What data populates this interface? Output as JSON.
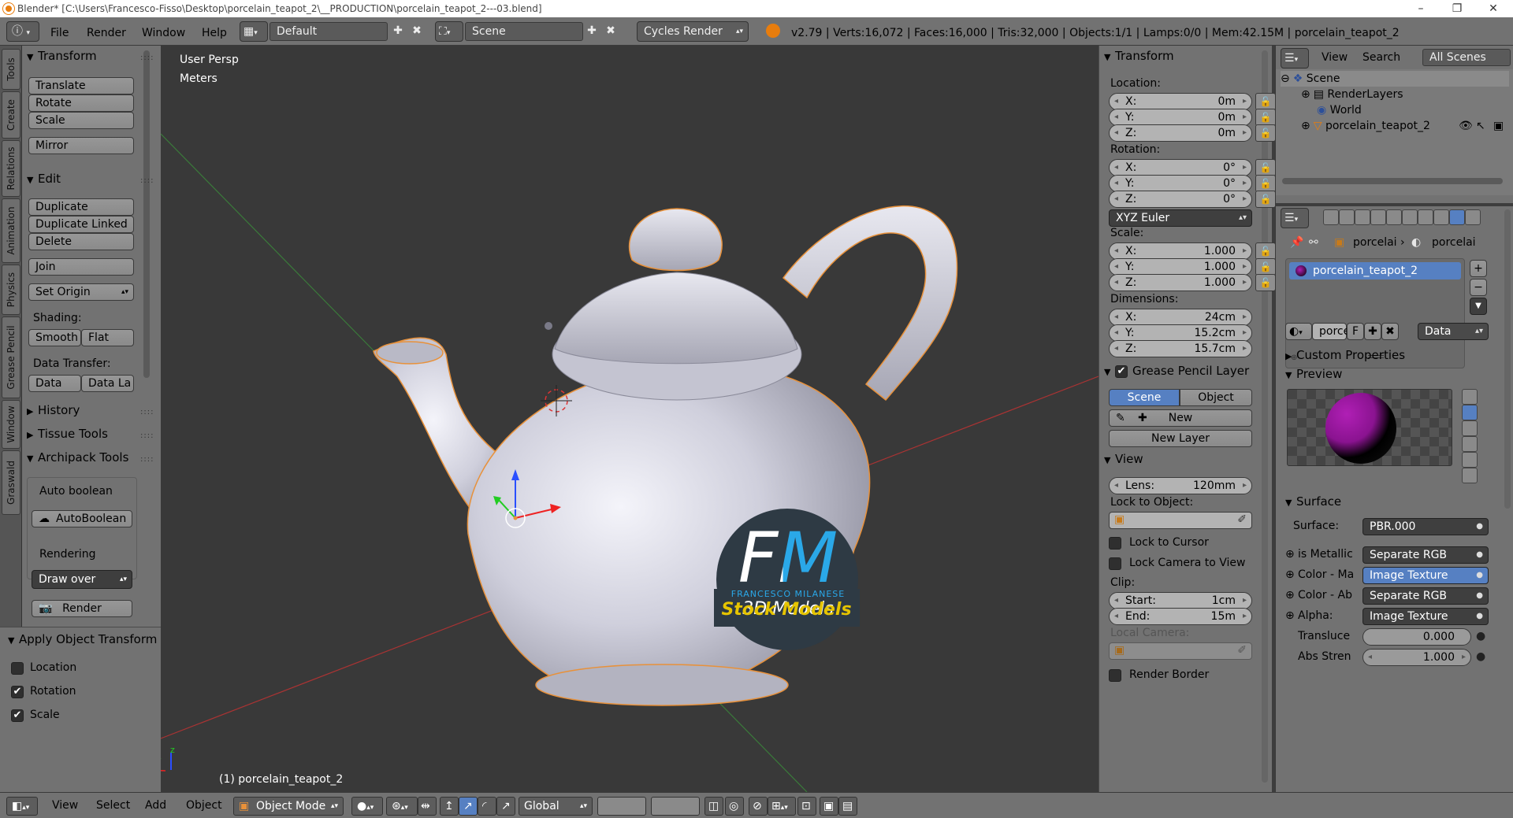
{
  "window": {
    "title": "Blender* [C:\\Users\\Francesco-Fisso\\Desktop\\porcelain_teapot_2\\__PRODUCTION\\porcelain_teapot_2---03.blend]"
  },
  "info_header": {
    "menus": [
      "File",
      "Render",
      "Window",
      "Help"
    ],
    "screen_layout": "Default",
    "scene": "Scene",
    "render_engine": "Cycles Render",
    "stats": "v2.79 | Verts:16,072 | Faces:16,000 | Tris:32,000 | Objects:1/1 | Lamps:0/0 | Mem:42.15M | porcelain_teapot_2"
  },
  "left_tabs": [
    "Tools",
    "Create",
    "Relations",
    "Animation",
    "Physics",
    "Grease Pencil",
    "Window",
    "Graswald"
  ],
  "tool_shelf": {
    "transform": {
      "title": "Transform",
      "buttons": [
        "Translate",
        "Rotate",
        "Scale",
        "Mirror"
      ]
    },
    "edit": {
      "title": "Edit",
      "buttons": [
        "Duplicate",
        "Duplicate Linked",
        "Delete",
        "Join",
        "Set Origin"
      ],
      "shading_label": "Shading:",
      "smooth": "Smooth",
      "flat": "Flat",
      "data_transfer_label": "Data Transfer:",
      "data": "Data",
      "data_la": "Data La"
    },
    "history": "History",
    "tissue_tools": "Tissue Tools",
    "archipack": {
      "title": "Archipack Tools",
      "auto_boolean": "Auto boolean",
      "autoboolean_btn": "AutoBoolean",
      "rendering": "Rendering",
      "draw_over": "Draw over",
      "render": "Render"
    }
  },
  "apply_object_transform": {
    "title": "Apply Object Transform",
    "options": [
      {
        "label": "Location",
        "checked": false
      },
      {
        "label": "Rotation",
        "checked": true
      },
      {
        "label": "Scale",
        "checked": true
      }
    ]
  },
  "viewport": {
    "view_name": "User Persp",
    "units": "Meters",
    "object_label": "(1) porcelain_teapot_2",
    "watermark": {
      "fm": "FM",
      "author": "FRANCESCO MILANESE",
      "sub": "3D Models",
      "stock": "Stock Models"
    },
    "colors": {
      "grid_x": "#a33",
      "grid_y": "#3a7a3a",
      "teapot": "#d4d4e0",
      "outline": "#e8913a"
    }
  },
  "n_panel": {
    "transform_title": "Transform",
    "location_label": "Location:",
    "location": [
      {
        "k": "X:",
        "v": "0m"
      },
      {
        "k": "Y:",
        "v": "0m"
      },
      {
        "k": "Z:",
        "v": "0m"
      }
    ],
    "rotation_label": "Rotation:",
    "rotation": [
      {
        "k": "X:",
        "v": "0°"
      },
      {
        "k": "Y:",
        "v": "0°"
      },
      {
        "k": "Z:",
        "v": "0°"
      }
    ],
    "rotation_mode": "XYZ Euler",
    "scale_label": "Scale:",
    "scale": [
      {
        "k": "X:",
        "v": "1.000"
      },
      {
        "k": "Y:",
        "v": "1.000"
      },
      {
        "k": "Z:",
        "v": "1.000"
      }
    ],
    "dimensions_label": "Dimensions:",
    "dimensions": [
      {
        "k": "X:",
        "v": "24cm"
      },
      {
        "k": "Y:",
        "v": "15.2cm"
      },
      {
        "k": "Z:",
        "v": "15.7cm"
      }
    ],
    "grease_pencil_title": "Grease Pencil Layer",
    "gp_scene": "Scene",
    "gp_object": "Object",
    "gp_new": "New",
    "gp_new_layer": "New Layer",
    "view_title": "View",
    "lens": {
      "k": "Lens:",
      "v": "120mm"
    },
    "lock_to_object": "Lock to Object:",
    "lock_to_cursor": "Lock to Cursor",
    "lock_camera": "Lock Camera to View",
    "clip_label": "Clip:",
    "clip_start": {
      "k": "Start:",
      "v": "1cm"
    },
    "clip_end": {
      "k": "End:",
      "v": "15m"
    },
    "local_camera": "Local Camera:",
    "render_border": "Render Border"
  },
  "outliner": {
    "menus": [
      "View",
      "Search"
    ],
    "filter": "All Scenes",
    "items": [
      "Scene",
      "RenderLayers",
      "World",
      "porcelain_teapot_2"
    ]
  },
  "properties": {
    "breadcrumb": [
      "porcelai",
      "porcelai"
    ],
    "material_slot": "porcelain_teapot_2",
    "material_name": "porce",
    "f_label": "F",
    "data_select": "Data",
    "custom_props": "Custom Properties",
    "preview": "Preview",
    "surface_title": "Surface",
    "surface_label": "Surface:",
    "surface_value": "PBR.000",
    "inputs": [
      {
        "label": "is Metallic",
        "value": "Separate RGB"
      },
      {
        "label": "Color - Ma",
        "value": "Image Texture"
      },
      {
        "label": "Color - Ab",
        "value": "Separate RGB"
      },
      {
        "label": "Alpha:",
        "value": "Image Texture"
      },
      {
        "label": "Transluce",
        "value": "0.000"
      },
      {
        "label": "Abs Stren",
        "value": "1.000"
      }
    ],
    "colors": {
      "selected": "#5680c2",
      "sphere": "#b01fb5"
    }
  },
  "bottom_header": {
    "menus": [
      "View",
      "Select",
      "Add",
      "Object"
    ],
    "mode": "Object Mode",
    "orientation": "Global"
  }
}
